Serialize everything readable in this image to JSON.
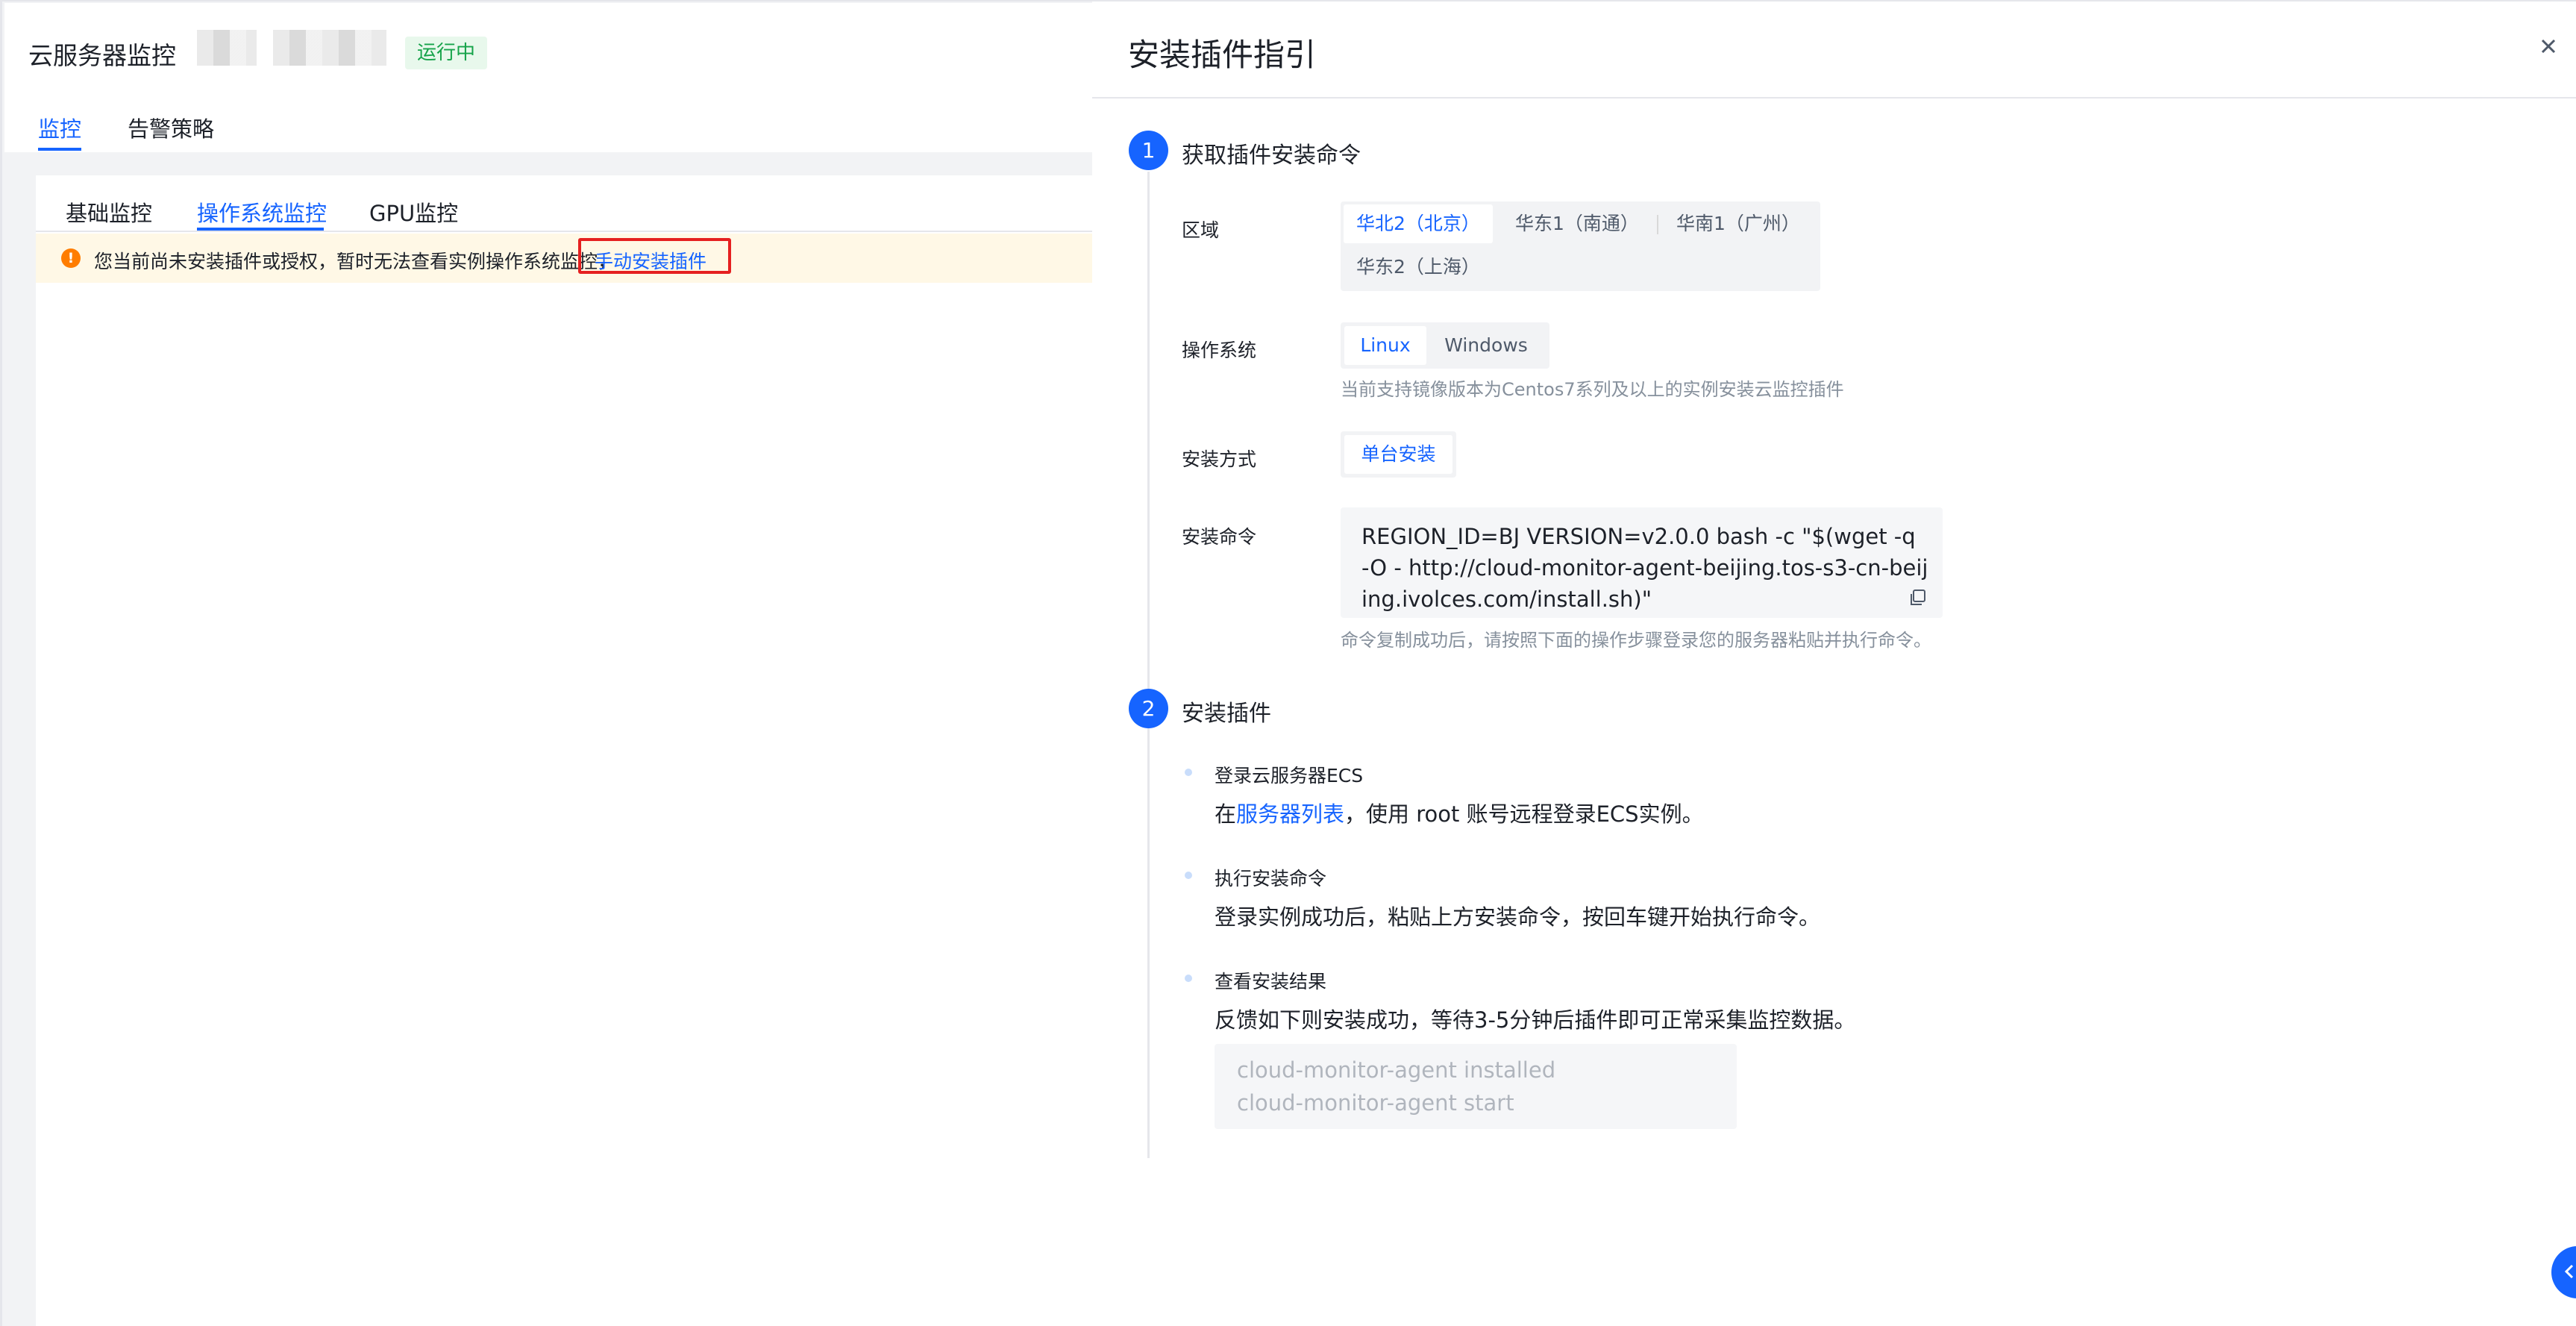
{
  "header": {
    "title": "云服务器监控",
    "status": "运行中",
    "tabs": [
      "监控",
      "告警策略"
    ]
  },
  "card": {
    "subtabs": [
      "基础监控",
      "操作系统监控",
      "GPU监控"
    ],
    "warning": {
      "text": "您当前尚未安装插件或授权，暂时无法查看实例操作系统监控，",
      "link": "手动安装插件"
    }
  },
  "drawer": {
    "title": "安装插件指引",
    "step1": {
      "number": "1",
      "title": "获取插件安装命令",
      "region_label": "区域",
      "regions": [
        "华北2（北京）",
        "华东1（南通）",
        "华南1（广州）",
        "华东2（上海）"
      ],
      "os_label": "操作系统",
      "os_options": [
        "Linux",
        "Windows"
      ],
      "os_hint": "当前支持镜像版本为Centos7系列及以上的实例安装云监控插件",
      "method_label": "安装方式",
      "method_option": "单台安装",
      "command_label": "安装命令",
      "command": "REGION_ID=BJ VERSION=v2.0.0 bash -c \"$(wget -q -O - http://cloud-monitor-agent-beijing.tos-s3-cn-beijing.ivolces.com/install.sh)\"",
      "command_hint": "命令复制成功后，请按照下面的操作步骤登录您的服务器粘贴并执行命令。"
    },
    "step2": {
      "number": "2",
      "title": "安装插件",
      "items": [
        {
          "title": "登录云服务器ECS",
          "desc_prefix": "在",
          "desc_link": "服务器列表",
          "desc_suffix": "，使用 root 账号远程登录ECS实例。"
        },
        {
          "title": "执行安装命令",
          "desc": "登录实例成功后，粘贴上方安装命令，按回车键开始执行命令。"
        },
        {
          "title": "查看安装结果",
          "desc": "反馈如下则安装成功，等待3-5分钟后插件即可正常采集监控数据。"
        }
      ],
      "result_lines": [
        "cloud-monitor-agent installed",
        "cloud-monitor-agent start"
      ]
    }
  },
  "colors": {
    "primary": "#1664ff",
    "success": "#16a34a",
    "warning": "#ff7d00",
    "highlight": "#e52020"
  }
}
